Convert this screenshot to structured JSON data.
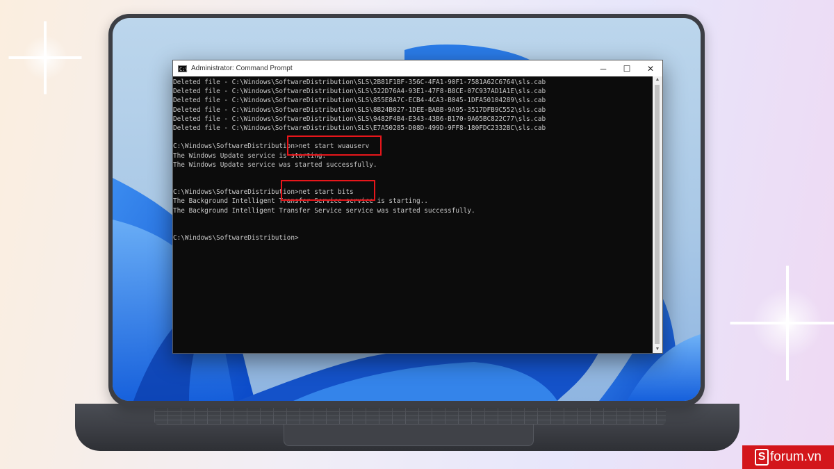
{
  "window": {
    "title": "Administrator: Command Prompt",
    "icon": "cmd-icon",
    "controls": {
      "minimize": "─",
      "maximize": "☐",
      "close": "✕"
    }
  },
  "console": {
    "lines": [
      "Deleted file - C:\\Windows\\SoftwareDistribution\\SLS\\2B81F1BF-356C-4FA1-90F1-7581A62C6764\\sls.cab",
      "Deleted file - C:\\Windows\\SoftwareDistribution\\SLS\\522D76A4-93E1-47F8-B8CE-07C937AD1A1E\\sls.cab",
      "Deleted file - C:\\Windows\\SoftwareDistribution\\SLS\\855E8A7C-ECB4-4CA3-B045-1DFA50104289\\sls.cab",
      "Deleted file - C:\\Windows\\SoftwareDistribution\\SLS\\8B24B027-1DEE-BABB-9A95-3517DFB9C552\\sls.cab",
      "Deleted file - C:\\Windows\\SoftwareDistribution\\SLS\\9482F4B4-E343-43B6-B170-9A65BC822C77\\sls.cab",
      "Deleted file - C:\\Windows\\SoftwareDistribution\\SLS\\E7A50285-D08D-499D-9FF8-180FDC2332BC\\sls.cab",
      "",
      "C:\\Windows\\SoftwareDistribution>net start wuauserv",
      "The Windows Update service is starting.",
      "The Windows Update service was started successfully.",
      "",
      "",
      "C:\\Windows\\SoftwareDistribution>net start bits",
      "The Background Intelligent Transfer Service service is starting..",
      "The Background Intelligent Transfer Service service was started successfully.",
      "",
      "",
      "C:\\Windows\\SoftwareDistribution>"
    ]
  },
  "brand": {
    "logo": "S",
    "name": "forum.vn"
  },
  "colors": {
    "highlight": "#e8161b",
    "brand": "#d3161b",
    "console_bg": "#0c0c0c",
    "console_text": "#c8c8c8"
  }
}
